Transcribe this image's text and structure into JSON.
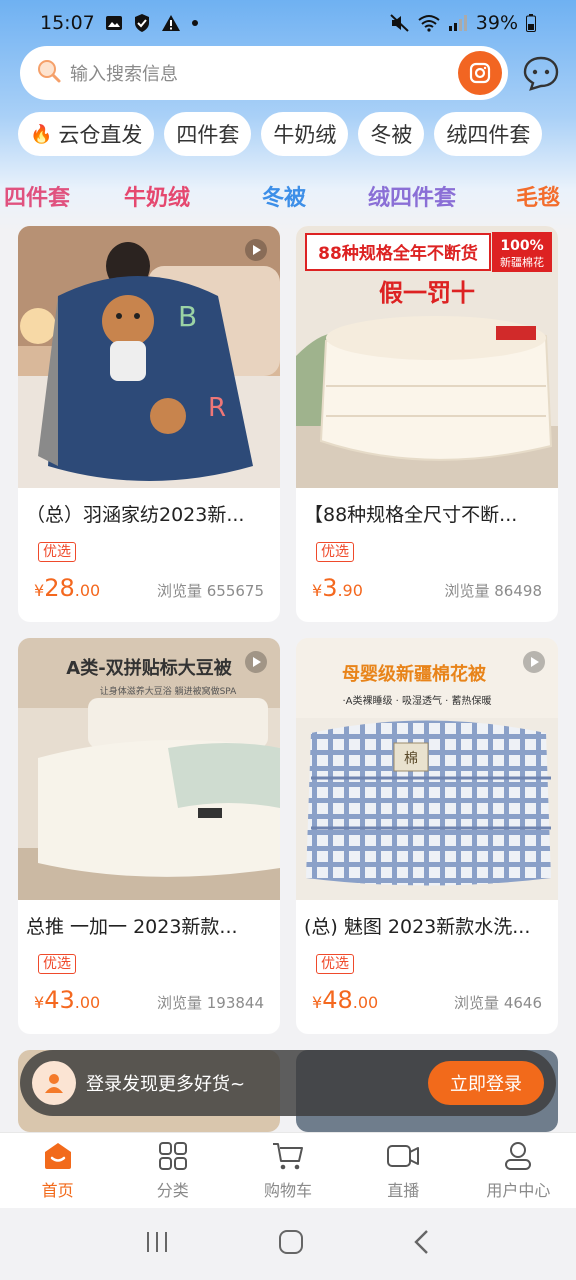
{
  "status_bar": {
    "time": "15:07",
    "battery": "39%"
  },
  "search": {
    "placeholder": "输入搜索信息"
  },
  "chips": [
    "云仓直发",
    "四件套",
    "牛奶绒",
    "冬被",
    "绒四件套"
  ],
  "banner": [
    "四件套",
    "牛奶绒",
    "冬被",
    "绒四件套",
    "毛毯"
  ],
  "products": [
    {
      "title": "（总）羽涵家纺2023新...",
      "badge": "优选",
      "yen": "¥",
      "price_int": "28",
      "price_dec": ".00",
      "views": "浏览量 655675"
    },
    {
      "title": "【88种规格全尺寸不断...",
      "badge": "优选",
      "yen": "¥",
      "price_int": "3",
      "price_dec": ".90",
      "views": "浏览量 86498",
      "img_text_top": "88种规格全年不断货",
      "img_text_badge_top": "100%",
      "img_text_badge_bottom": "新疆棉花",
      "img_text_main": "假一罚十"
    },
    {
      "title": "总推 一加一 2023新款...",
      "badge": "优选",
      "yen": "¥",
      "price_int": "43",
      "price_dec": ".00",
      "views": "浏览量 193844",
      "img_text_top": "A类-双拼贴标大豆被",
      "img_text_sub": "让身体滋养大豆浴 躺进被窝做SPA"
    },
    {
      "title": "(总) 魅图 2023新款水洗...",
      "badge": "优选",
      "yen": "¥",
      "price_int": "48",
      "price_dec": ".00",
      "views": "浏览量 4646",
      "img_text_top": "母婴级新疆棉花被",
      "img_text_sub": "·A类裸睡级 · 吸湿透气 · 蓄热保暖",
      "img_tag": "棉"
    }
  ],
  "login_bar": {
    "text": "登录发现更多好货~",
    "button": "立即登录"
  },
  "tabs": [
    {
      "label": "首页",
      "icon": "home-icon",
      "active": true
    },
    {
      "label": "分类",
      "icon": "category-icon",
      "active": false
    },
    {
      "label": "购物车",
      "icon": "cart-icon",
      "active": false
    },
    {
      "label": "直播",
      "icon": "live-icon",
      "active": false
    },
    {
      "label": "用户中心",
      "icon": "user-icon",
      "active": false
    }
  ],
  "colors": {
    "accent": "#f26a1b",
    "price": "#f4681f",
    "header_blue": "#6fb1f2"
  }
}
